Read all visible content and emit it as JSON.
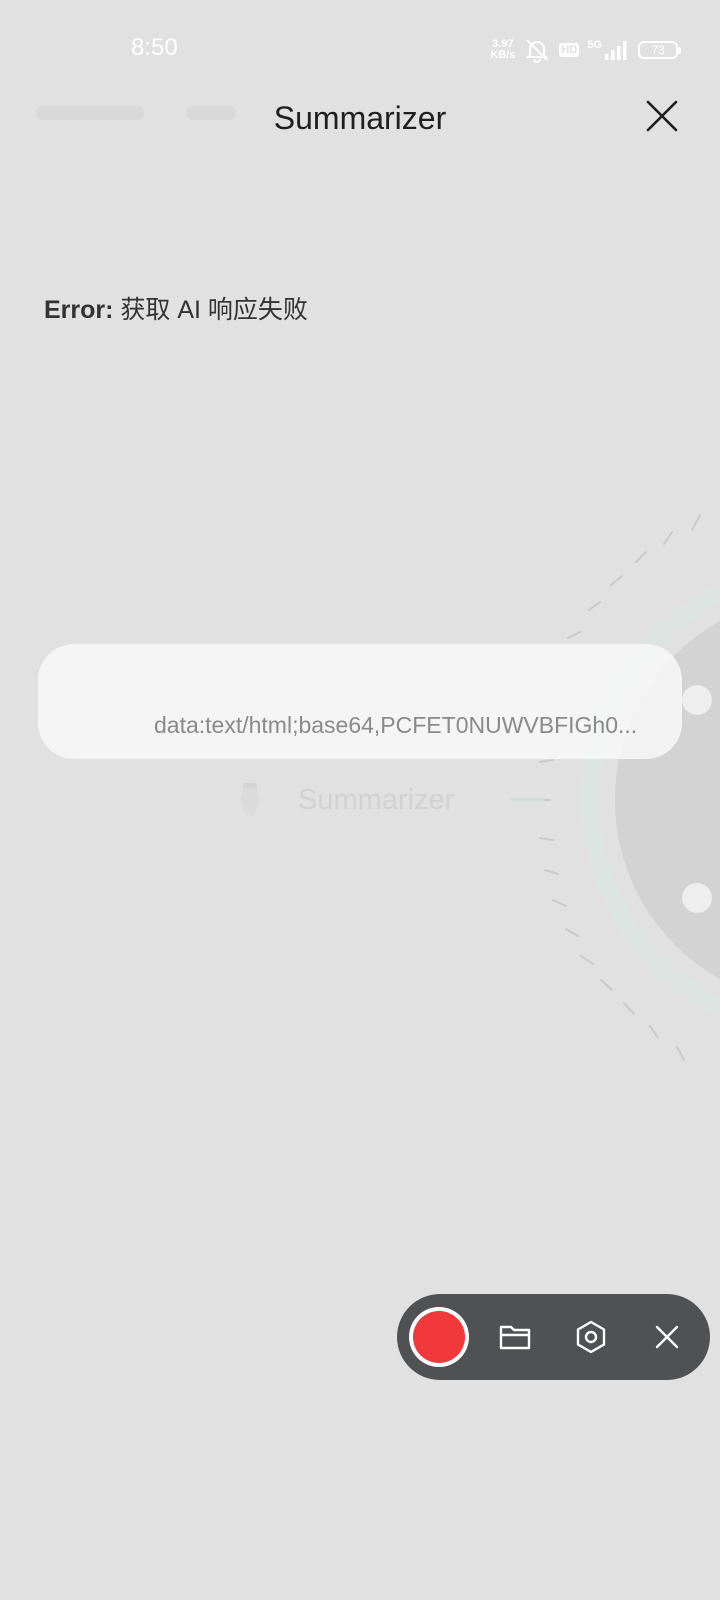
{
  "status_bar": {
    "time": "8:50",
    "net_speed_value": "3.97",
    "net_speed_unit": "KB/s",
    "hd_label": "HD",
    "network_type": "5G",
    "battery_level": "73"
  },
  "header": {
    "title": "Summarizer"
  },
  "error": {
    "label": "Error:",
    "message": "获取 AI 响应失败"
  },
  "url_bar": {
    "text": "data:text/html;base64,PCFET0NUWVBFIGh0..."
  },
  "background": {
    "ghost_label": "Summarizer"
  },
  "recorder": {
    "record_color": "#f1383b",
    "toolbar_color": "#4f5152"
  }
}
